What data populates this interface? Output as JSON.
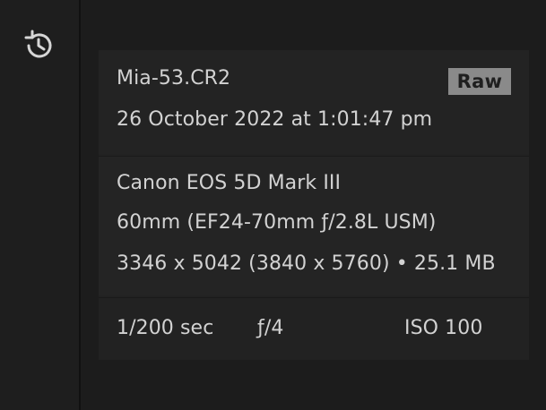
{
  "sidebar": {
    "history_icon": "history-icon"
  },
  "file": {
    "filename": "Mia-53.CR2",
    "datetime": "26 October 2022 at 1:01:47 pm",
    "badge": "Raw"
  },
  "camera": {
    "model": "Canon EOS 5D Mark III",
    "lens": "60mm (EF24-70mm ƒ/2.8L USM)",
    "dimensions": "3346 x 5042 (3840 x 5760) • 25.1 MB"
  },
  "exposure": {
    "shutter": "1/200 sec",
    "aperture": "ƒ/4",
    "iso": "ISO 100"
  },
  "colors": {
    "background": "#1c1c1c",
    "panel": "#222222",
    "text": "#d2d2d2",
    "badge_bg": "#8a8a8a",
    "badge_text": "#1f1f1f"
  }
}
